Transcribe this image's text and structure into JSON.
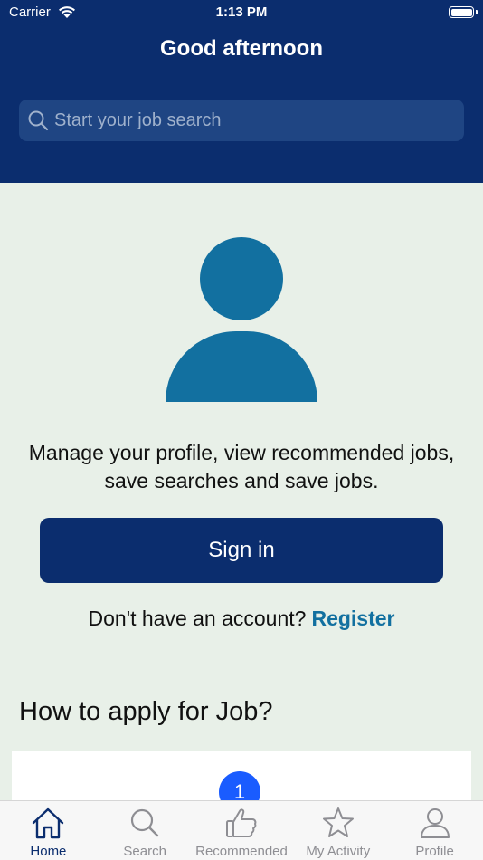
{
  "status_bar": {
    "carrier": "Carrier",
    "time": "1:13 PM"
  },
  "header": {
    "greeting": "Good afternoon"
  },
  "search": {
    "placeholder": "Start your job search"
  },
  "profile_prompt": "Manage your profile, view recommended jobs, save searches and save jobs.",
  "signin_label": "Sign in",
  "register": {
    "prompt": "Don't have an account?",
    "link": "Register"
  },
  "how_to_apply": {
    "title": "How to apply for Job?",
    "first_step": "1"
  },
  "tabs": [
    {
      "label": "Home",
      "icon": "home-icon",
      "active": true
    },
    {
      "label": "Search",
      "icon": "search-icon",
      "active": false
    },
    {
      "label": "Recommended",
      "icon": "thumbs-up-icon",
      "active": false
    },
    {
      "label": "My Activity",
      "icon": "star-icon",
      "active": false
    },
    {
      "label": "Profile",
      "icon": "person-icon",
      "active": false
    }
  ],
  "colors": {
    "header_bg": "#0b2d6e",
    "accent": "#1270a0",
    "page_bg": "#e8f0e8",
    "step_badge": "#1a5cff"
  }
}
